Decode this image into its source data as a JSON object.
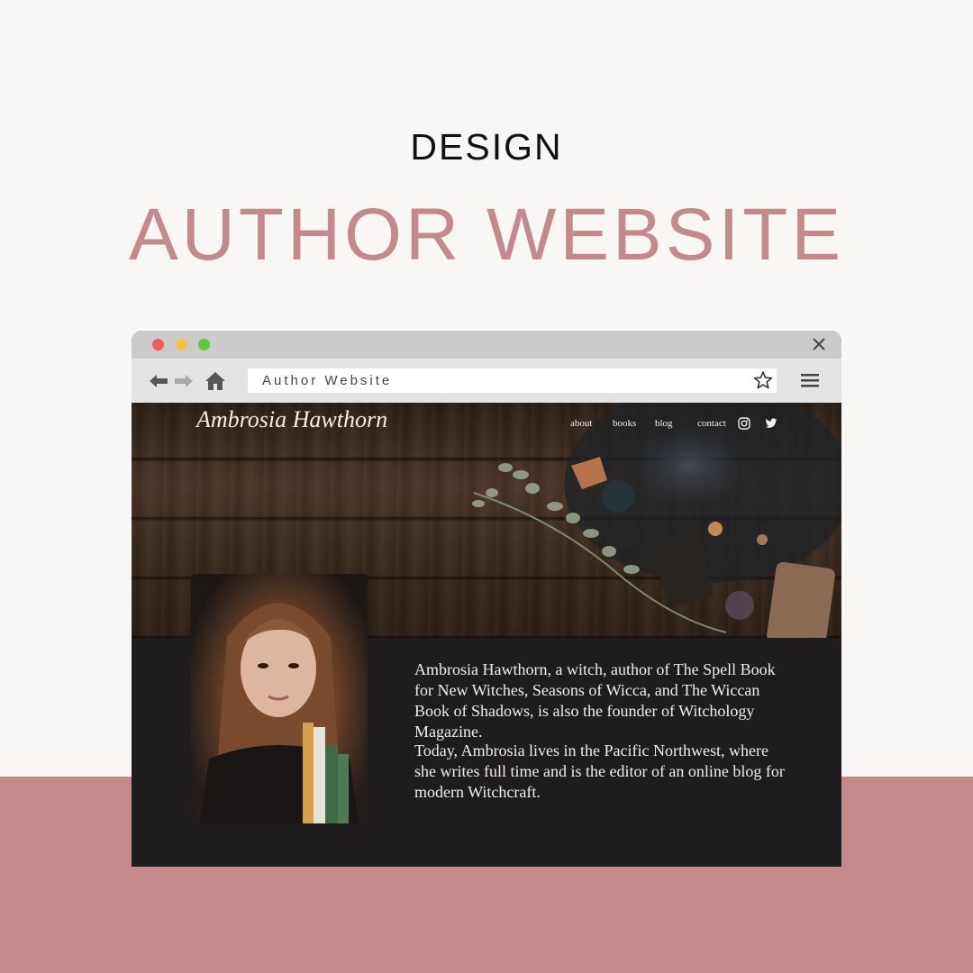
{
  "heading": {
    "eyebrow": "DESIGN",
    "title": "AUTHOR WEBSITE"
  },
  "colors": {
    "accent_pink": "#c48a8b",
    "page_bg": "#f9f7f5",
    "site_dark": "#1e1c1d"
  },
  "browser": {
    "address_text": "Author Website",
    "icons": [
      "back-arrow-icon",
      "forward-arrow-icon",
      "home-icon",
      "star-icon",
      "hamburger-menu-icon",
      "close-icon"
    ]
  },
  "site": {
    "brand": "Ambrosia Hawthorn",
    "nav": [
      "about",
      "books",
      "blog",
      "contact"
    ],
    "social_icons": [
      "instagram-icon",
      "twitter-icon"
    ],
    "bio_paragraph_1": "Ambrosia Hawthorn, a witch, author of The Spell Book for New Witches, Seasons of Wicca, and The Wiccan Book of Shadows, is also the founder of Witchology Magazine.",
    "bio_paragraph_2": "Today, Ambrosia lives in the Pacific Northwest, where she writes full time and is the editor of an online blog for modern Witchcraft."
  }
}
